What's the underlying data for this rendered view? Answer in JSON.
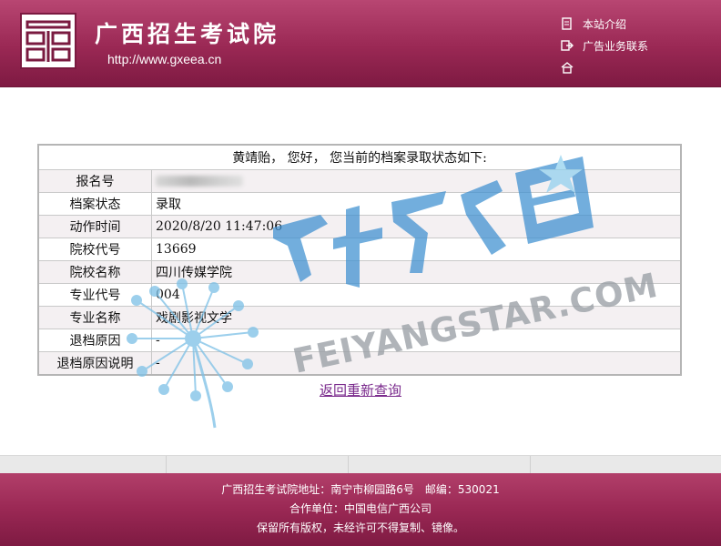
{
  "header": {
    "site_name": "广西招生考试院",
    "site_url": "http://www.gxeea.cn",
    "nav": [
      {
        "label": "本站介绍",
        "icon": "document-icon"
      },
      {
        "label": "广告业务联系",
        "icon": "export-icon"
      },
      {
        "label": "",
        "icon": "home-icon"
      }
    ]
  },
  "status": {
    "heading": "黄靖贻， 您好， 您当前的档案录取状态如下:",
    "rows": [
      {
        "label": "报名号",
        "value": ""
      },
      {
        "label": "档案状态",
        "value": "录取"
      },
      {
        "label": "动作时间",
        "value": "2020/8/20 11:47:06"
      },
      {
        "label": "院校代号",
        "value": "13669"
      },
      {
        "label": "院校名称",
        "value": "四川传媒学院"
      },
      {
        "label": "专业代号",
        "value": "004"
      },
      {
        "label": "专业名称",
        "value": "戏剧影视文学"
      },
      {
        "label": "退档原因",
        "value": "-"
      },
      {
        "label": "退档原因说明",
        "value": "-"
      }
    ]
  },
  "back_link": "返回重新查询",
  "watermark": {
    "text": "FEIYANGSTAR.COM",
    "brand": "飞扬之星"
  },
  "footer": {
    "address": "广西招生考试院地址：南宁市柳园路6号　邮编：530021",
    "partner": "合作单位：中国电信广西公司",
    "copyright": "保留所有版权，未经许可不得复制、镜像。"
  },
  "colors": {
    "header_bg": "#9a2854",
    "link": "#7a2a8c",
    "watermark_blue": "#3c8fd0"
  }
}
